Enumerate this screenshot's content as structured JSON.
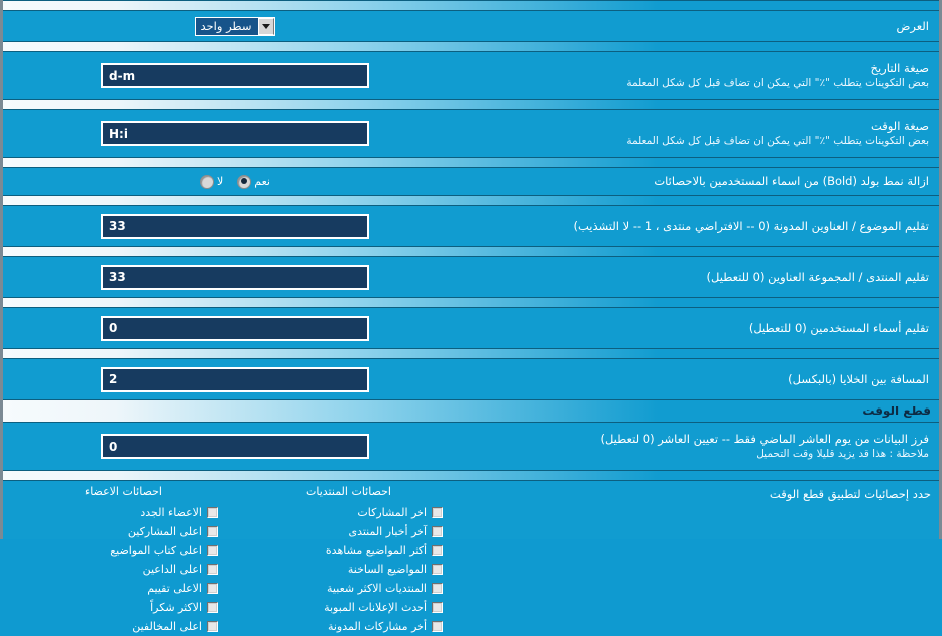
{
  "display_row": {
    "label": "العرض",
    "select": {
      "value": "سطر واحد",
      "arrow_icon": "chevron-down-icon"
    }
  },
  "date_format_row": {
    "label": "صيغة التاريخ",
    "sub": "بعض التكوينات يتطلب \"٪\" التي يمكن ان تضاف قبل كل شكل المعلمة",
    "value": "d-m"
  },
  "time_format_row": {
    "label": "صيغة الوقت",
    "sub": "بعض التكوينات يتطلب \"٪\" التي يمكن ان تضاف قبل كل شكل المعلمة",
    "value": "H:i"
  },
  "bold_row": {
    "label": "ازالة نمط بولد (Bold) من اسماء المستخدمين بالاحصائات",
    "options": [
      {
        "label": "نعم",
        "selected": true
      },
      {
        "label": "لا",
        "selected": false
      }
    ]
  },
  "topic_trim_row": {
    "label": "تقليم الموضوع / العناوين المدونة (0 -- الافتراضي منتدى ، 1 -- لا التشذيب)",
    "value": "33"
  },
  "forum_trim_row": {
    "label": "تقليم المنتدى / المجموعة العناوين (0 للتعطيل)",
    "value": "33"
  },
  "username_trim_row": {
    "label": "تقليم أسماء المستخدمين (0 للتعطيل)",
    "value": "0"
  },
  "cellspacing_row": {
    "label": "المسافة بين الخلايا (بالبكسل)",
    "value": "2"
  },
  "cutoff_section": {
    "title": "قطع الوقت"
  },
  "cutoff_row": {
    "label": "فرز البيانات من يوم العاشر الماضي فقط -- تعيين العاشر (0 لتعطيل)",
    "sub": "ملاحظة : هذا قد يزيد قليلا وقت التحميل",
    "value": "0"
  },
  "stats_section": {
    "heading": "حدد إحصائيات لتطبيق قطع الوقت",
    "columns": [
      {
        "title": "احصائات الاعضاء",
        "items": [
          {
            "label": "الاعضاء الجدد",
            "checked": false
          },
          {
            "label": "اعلى المشاركين",
            "checked": false
          },
          {
            "label": "اعلى كتاب المواضيع",
            "checked": false
          },
          {
            "label": "اعلى الداعين",
            "checked": false
          },
          {
            "label": "الاعلى تقييم",
            "checked": false
          },
          {
            "label": "الاكثر شكراً",
            "checked": false
          },
          {
            "label": "اعلى المخالفين",
            "checked": false
          }
        ]
      },
      {
        "title": "احصائات المنتديات",
        "items": [
          {
            "label": "اخر المشاركات",
            "checked": false
          },
          {
            "label": "آخر أخبار المنتدى",
            "checked": false
          },
          {
            "label": "أكثر المواضيع مشاهدة",
            "checked": false
          },
          {
            "label": "المواضيع الساخنة",
            "checked": false
          },
          {
            "label": "المنتديات الاكثر شعبية",
            "checked": false
          },
          {
            "label": "أحدث الإعلانات المبوبة",
            "checked": false
          },
          {
            "label": "أخر مشاركات المدونة",
            "checked": false
          }
        ]
      }
    ]
  }
}
